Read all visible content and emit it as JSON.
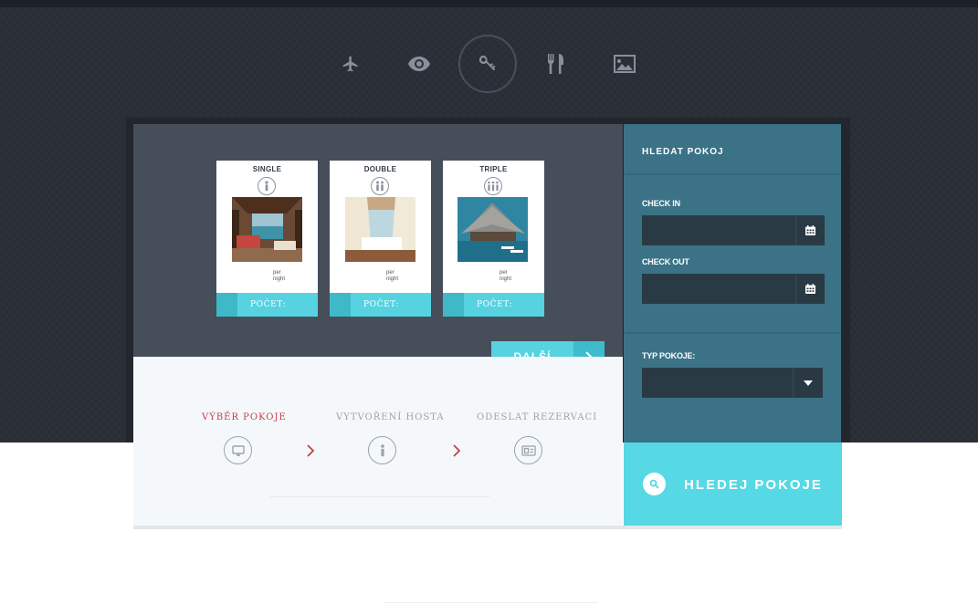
{
  "nav": {
    "items": [
      {
        "icon": "airplane-icon",
        "active": false
      },
      {
        "icon": "eye-icon",
        "active": false
      },
      {
        "icon": "key-icon",
        "active": true
      },
      {
        "icon": "fork-knife-icon",
        "active": false
      },
      {
        "icon": "image-icon",
        "active": false
      }
    ]
  },
  "rooms": [
    {
      "title": "SINGLE",
      "per": "per",
      "night": "night",
      "count_label": "POČET:",
      "icon": "single-person-icon"
    },
    {
      "title": "DOUBLE",
      "per": "per",
      "night": "night",
      "count_label": "POČET:",
      "icon": "two-persons-icon"
    },
    {
      "title": "TRIPLE",
      "per": "per",
      "night": "night",
      "count_label": "POČET:",
      "icon": "three-persons-icon"
    }
  ],
  "next_button": {
    "label": "DALŠÍ"
  },
  "steps": [
    {
      "label": "VÝBĚR POKOJE",
      "active": true,
      "icon": "monitor-icon"
    },
    {
      "label": "VYTVOŘENÍ HOSTA",
      "active": false,
      "icon": "person-icon"
    },
    {
      "label": "ODESLAT REZERVACI",
      "active": false,
      "icon": "id-card-icon"
    }
  ],
  "search": {
    "title": "HLEDAT POKOJ",
    "check_in_label": "CHECK IN",
    "check_in_value": "",
    "check_out_label": "CHECK OUT",
    "check_out_value": "",
    "room_type_label": "TYP POKOJE:",
    "room_type_value": "",
    "submit_label": "HLEDEJ POKOJE"
  },
  "colors": {
    "accent": "#56d2e1",
    "accent_dark": "#3fb8c8",
    "panel_blue": "#3b7286",
    "panel_gray": "#454e59",
    "active_step": "#c0414d",
    "background": "#2a2f38"
  }
}
